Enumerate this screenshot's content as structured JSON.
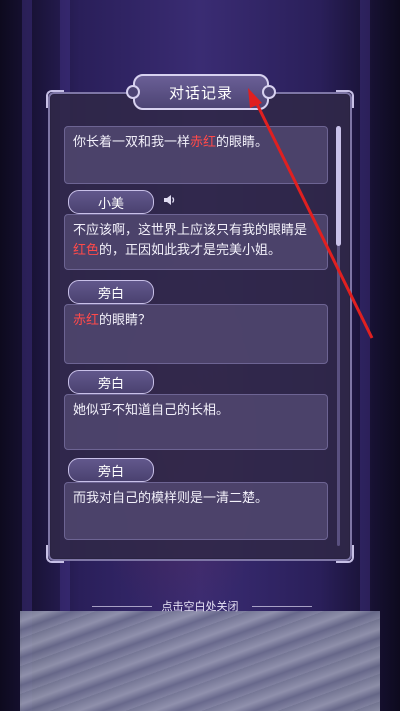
{
  "title": "对话记录",
  "entries": [
    {
      "speaker": "",
      "parts": [
        "你长着一双和我一样",
        "赤红",
        "的眼睛。"
      ]
    },
    {
      "speaker": "小美",
      "parts": [
        "不应该啊，这世界上应该只有我的眼睛是",
        "红色",
        "的，正因如此我才是完美小姐。"
      ]
    },
    {
      "speaker": "旁白",
      "parts": [
        "",
        "赤红",
        "的眼睛？"
      ]
    },
    {
      "speaker": "旁白",
      "parts": [
        "她似乎不知道自己的长相。",
        "",
        ""
      ]
    },
    {
      "speaker": "旁白",
      "parts": [
        "而我对自己的模样则是一清二楚。",
        "",
        ""
      ]
    }
  ],
  "close_hint": "点击空白处关闭",
  "icons": {
    "voice": "speaker-icon"
  },
  "colors": {
    "highlight": "#ff4a4a",
    "annotation_arrow": "#e02020"
  }
}
